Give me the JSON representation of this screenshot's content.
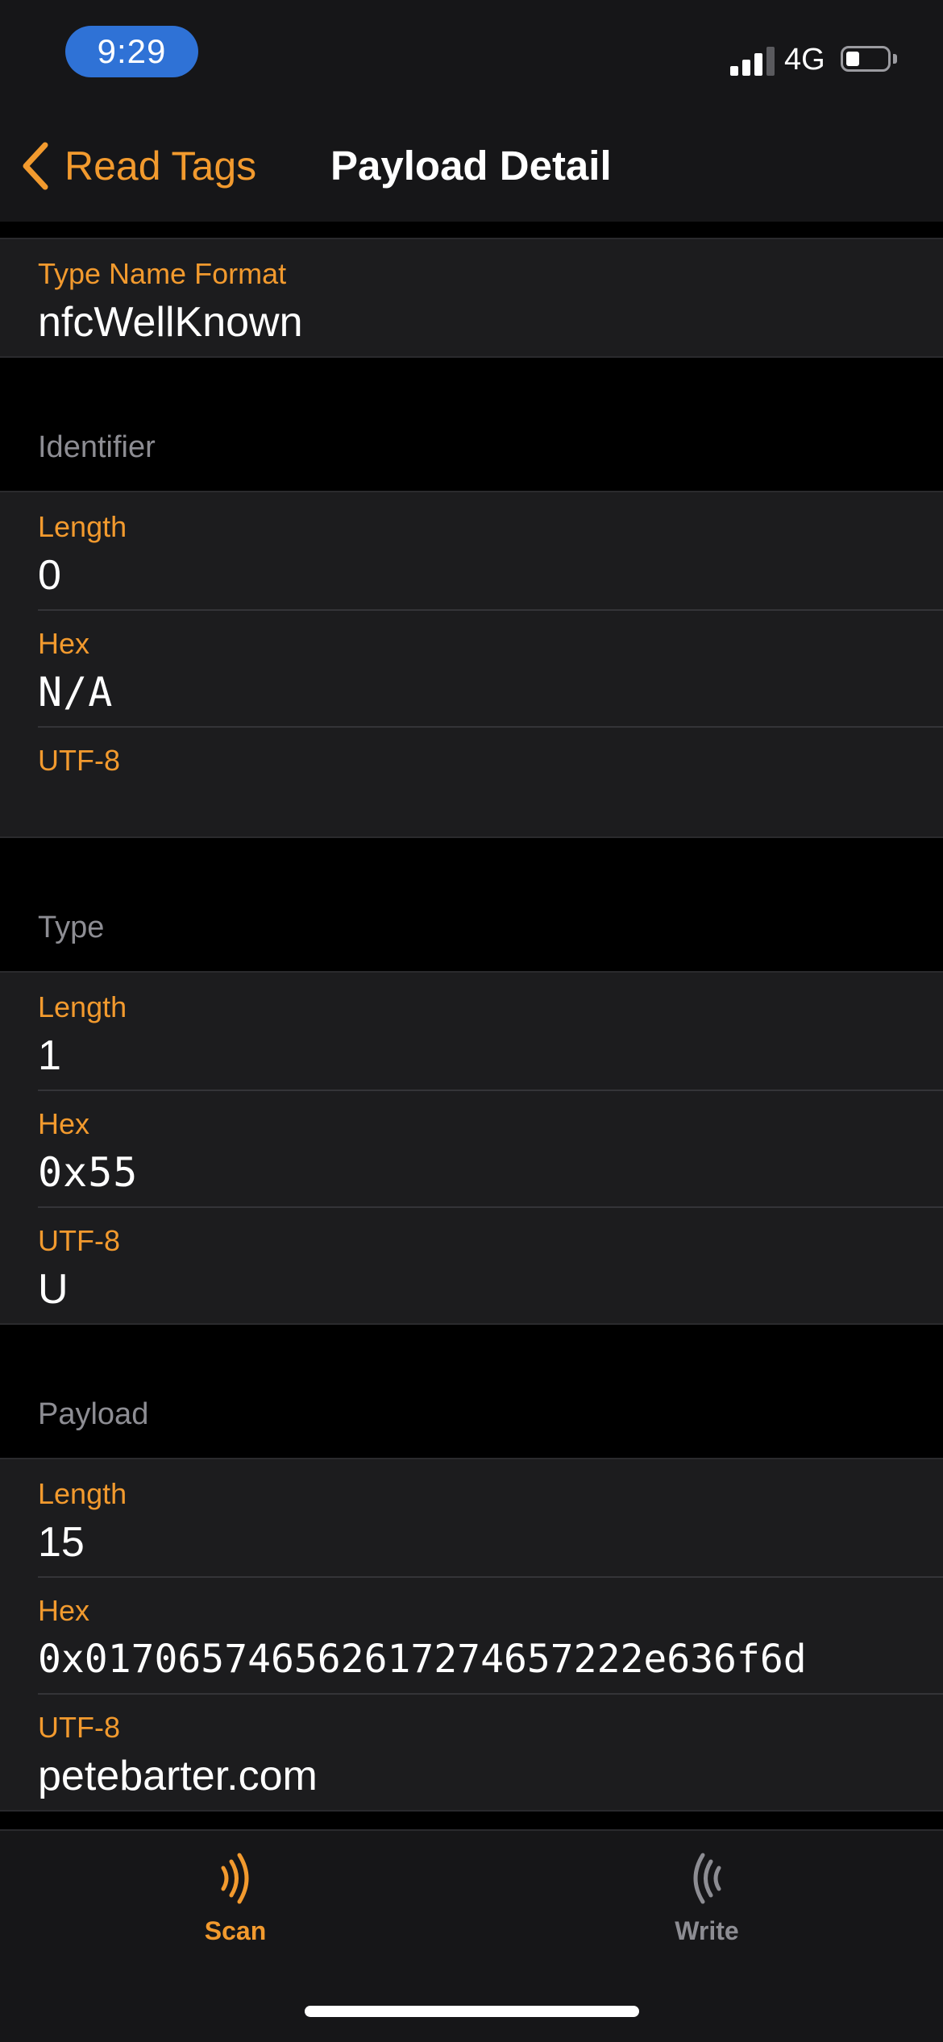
{
  "status_bar": {
    "time": "9:29",
    "network": "4G",
    "signal_bars_active": 3,
    "signal_bars_total": 4,
    "battery_level": 0.25
  },
  "nav": {
    "back_label": "Read Tags",
    "title": "Payload Detail",
    "back_icon": "chevron-left-icon"
  },
  "type_name_format": {
    "label": "Type Name Format",
    "value": "nfcWellKnown"
  },
  "sections": {
    "identifier": {
      "header": "Identifier",
      "length_label": "Length",
      "length_value": "0",
      "hex_label": "Hex",
      "hex_value": "N/A",
      "utf8_label": "UTF-8",
      "utf8_value": ""
    },
    "type": {
      "header": "Type",
      "length_label": "Length",
      "length_value": "1",
      "hex_label": "Hex",
      "hex_value": "0x55",
      "utf8_label": "UTF-8",
      "utf8_value": "U"
    },
    "payload": {
      "header": "Payload",
      "length_label": "Length",
      "length_value": "15",
      "hex_label": "Hex",
      "hex_value": "0x017065746562617274657222e636f6d",
      "utf8_label": "UTF-8",
      "utf8_value": "petebarter.com"
    }
  },
  "tabs": [
    {
      "label": "Scan",
      "icon": "nfc-scan-icon",
      "selected": true
    },
    {
      "label": "Write",
      "icon": "nfc-write-icon",
      "selected": false
    }
  ],
  "colors": {
    "accent": "#f29a2e",
    "background": "#000000",
    "cell_background": "#1c1c1e",
    "secondary_text": "#8d8d93",
    "time_pill": "#2f72d6"
  }
}
